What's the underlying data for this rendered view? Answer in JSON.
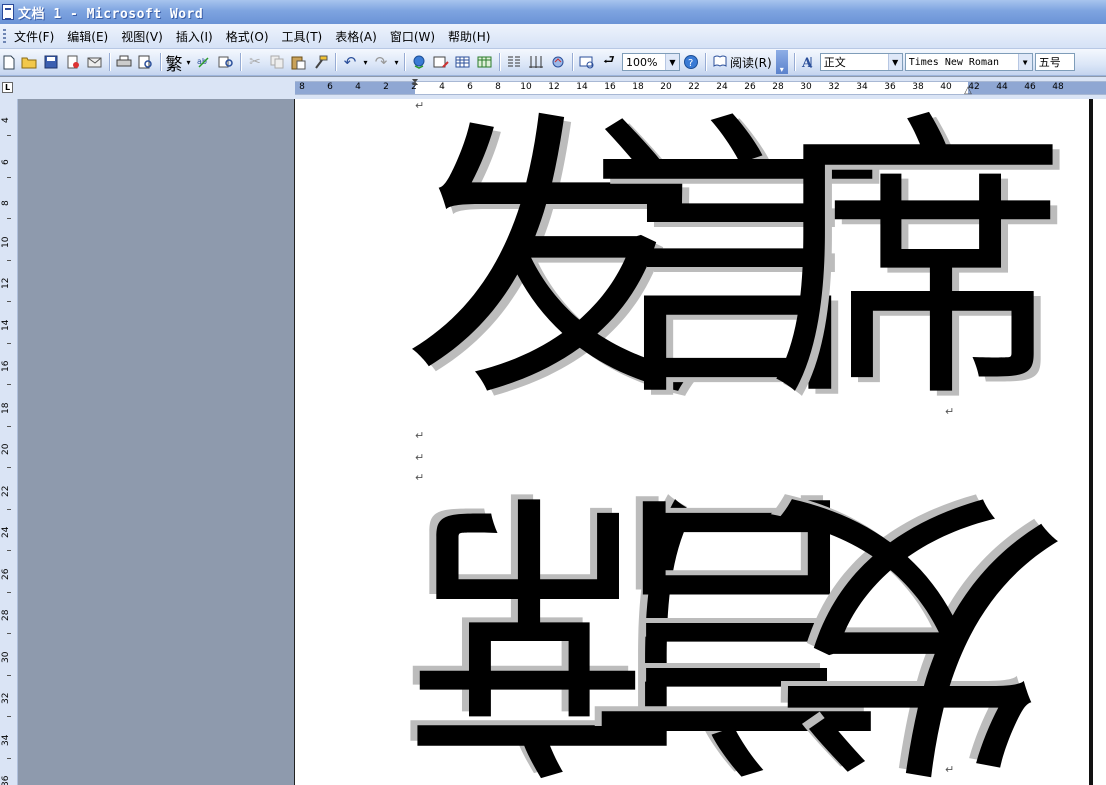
{
  "window": {
    "title": "文档 1 - Microsoft Word"
  },
  "menu": [
    {
      "label": "文件(F)"
    },
    {
      "label": "编辑(E)"
    },
    {
      "label": "视图(V)"
    },
    {
      "label": "插入(I)"
    },
    {
      "label": "格式(O)"
    },
    {
      "label": "工具(T)"
    },
    {
      "label": "表格(A)"
    },
    {
      "label": "窗口(W)"
    },
    {
      "label": "帮助(H)"
    }
  ],
  "toolbar": {
    "traditional_label": "繁",
    "zoom": "100%",
    "read_label": "阅读(R)",
    "style": "正文",
    "font": "Times New Roman",
    "size": "五号"
  },
  "ruler": {
    "numbers": [
      "8",
      "6",
      "4",
      "2",
      "2",
      "4",
      "6",
      "8",
      "10",
      "12",
      "14",
      "16",
      "18",
      "20",
      "22",
      "24",
      "26",
      "28",
      "30",
      "32",
      "34",
      "36",
      "38",
      "40",
      "42",
      "44",
      "46",
      "48"
    ],
    "vertical_numbers": [
      "4",
      "6",
      "8",
      "10",
      "12",
      "14",
      "16",
      "18",
      "20",
      "22",
      "24",
      "26",
      "28",
      "30",
      "32",
      "34",
      "36"
    ]
  },
  "document": {
    "line1_chars": [
      "发",
      "言",
      "席"
    ],
    "line2_chars": [
      "席",
      "言",
      "发"
    ],
    "para_mark": "↵"
  },
  "colors": {
    "titlebar": "#7ea4e0",
    "toolbar": "#dbe6f7",
    "workspace": "#8e9aad",
    "shadow": "#bcbcbc"
  }
}
